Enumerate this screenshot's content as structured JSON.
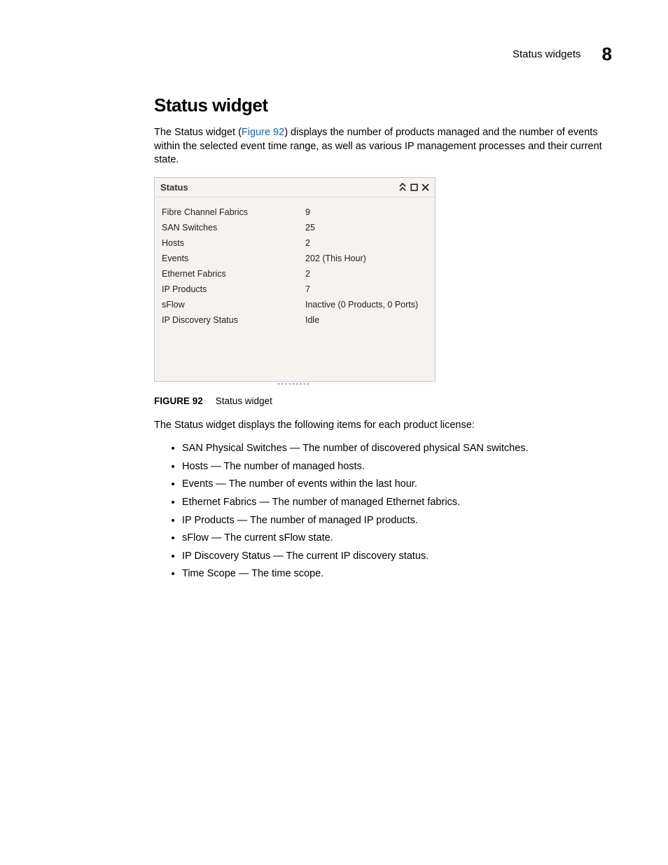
{
  "header": {
    "running_title": "Status widgets",
    "chapter_number": "8"
  },
  "section": {
    "title": "Status widget",
    "intro_pre": "The Status widget (",
    "intro_link": "Figure 92",
    "intro_post": ") displays the number of products managed and the number of events within the selected event time range, as well as various IP management processes and their current state."
  },
  "widget": {
    "title": "Status",
    "rows": [
      {
        "label": "Fibre Channel Fabrics",
        "value": "9"
      },
      {
        "label": "SAN Switches",
        "value": "25"
      },
      {
        "label": "Hosts",
        "value": "2"
      },
      {
        "label": "Events",
        "value": "202 (This Hour)"
      },
      {
        "label": "Ethernet Fabrics",
        "value": "2"
      },
      {
        "label": "IP Products",
        "value": "7"
      },
      {
        "label": "sFlow",
        "value": "Inactive (0 Products, 0 Ports)"
      },
      {
        "label": "IP Discovery Status",
        "value": "Idle"
      }
    ]
  },
  "figure": {
    "number": "FIGURE 92",
    "caption": "Status widget"
  },
  "list_intro": "The Status widget displays the following items for each product license:",
  "bullets": [
    "SAN Physical Switches — The number of discovered physical SAN switches.",
    "Hosts — The number of managed hosts.",
    "Events — The number of events within the last hour.",
    "Ethernet Fabrics — The number of managed Ethernet fabrics.",
    "IP Products — The number of managed IP products.",
    "sFlow — The current sFlow state.",
    "IP Discovery Status — The current IP discovery status.",
    "Time Scope — The time scope."
  ]
}
